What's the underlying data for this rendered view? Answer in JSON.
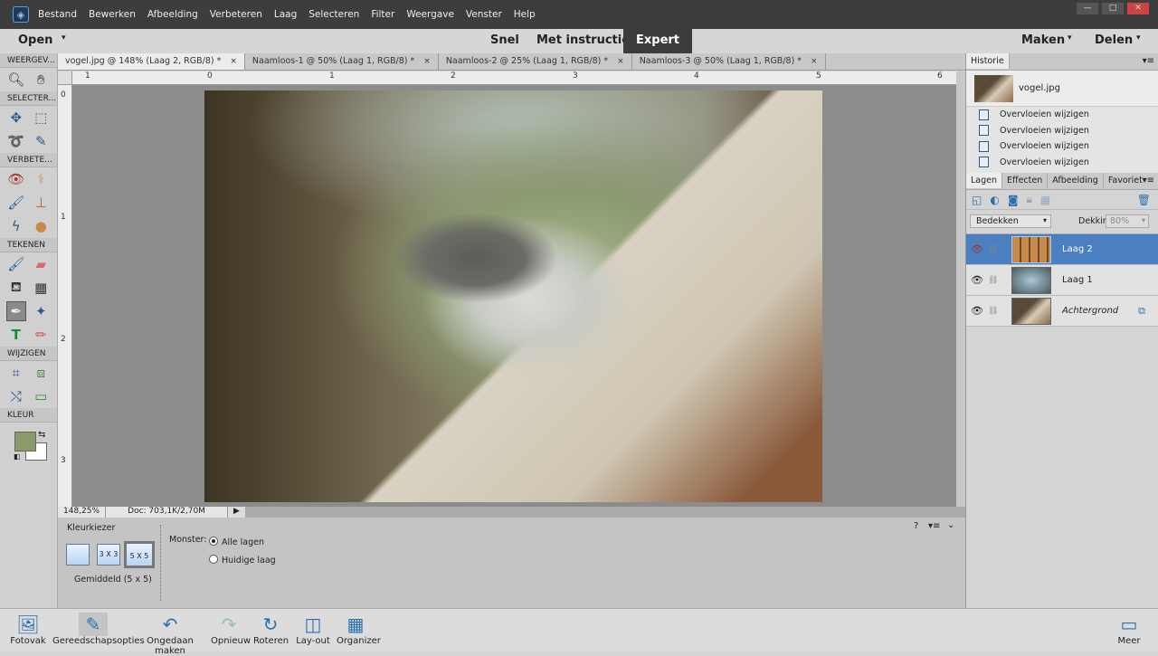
{
  "menu": [
    "Bestand",
    "Bewerken",
    "Afbeelding",
    "Verbeteren",
    "Laag",
    "Selecteren",
    "Filter",
    "Weergave",
    "Venster",
    "Help"
  ],
  "window_controls": {
    "minimize": "—",
    "maximize": "□",
    "close": "✕"
  },
  "modebar": {
    "open": "Open",
    "modes": [
      "Snel",
      "Met instructies",
      "Expert"
    ],
    "active_mode": "Expert",
    "maken": "Maken",
    "delen": "Delen"
  },
  "toolbox": {
    "sections": [
      "WEERGEV...",
      "SELECTER...",
      "VERBETE...",
      "TEKENEN",
      "WIJZIGEN",
      "KLEUR"
    ],
    "foreground_color": "#8a9a68",
    "background_color": "#ffffff"
  },
  "doc_tabs": [
    {
      "label": "vogel.jpg @ 148% (Laag 2, RGB/8) *",
      "close": "×"
    },
    {
      "label": "Naamloos-1 @ 50% (Laag 1, RGB/8) *",
      "close": "×"
    },
    {
      "label": "Naamloos-2 @ 25% (Laag 1, RGB/8) *",
      "close": "×"
    },
    {
      "label": "Naamloos-3 @ 50% (Laag 1, RGB/8) *",
      "close": "×"
    }
  ],
  "ruler_h": [
    "1",
    "0",
    "1",
    "2",
    "3",
    "4",
    "5",
    "6"
  ],
  "ruler_v": [
    "0",
    "1",
    "2",
    "3"
  ],
  "status": {
    "zoom": "148,25%",
    "doc": "Doc: 703,1K/2,70M"
  },
  "tool_options": {
    "title": "Kleurkiezer",
    "sizes": [
      "",
      "3 X 3",
      "5 X 5"
    ],
    "size_label": "Gemiddeld (5 x 5)",
    "monster_label": "Monster:",
    "options": [
      "Alle lagen",
      "Huidige laag"
    ],
    "selected": "Alle lagen"
  },
  "history": {
    "tab": "Historie",
    "source": "vogel.jpg",
    "items": [
      "Overvloeien wijzigen",
      "Overvloeien wijzigen",
      "Overvloeien wijzigen",
      "Overvloeien wijzigen"
    ]
  },
  "layers_panel": {
    "tabs": [
      "Lagen",
      "Effecten",
      "Afbeelding",
      "Favorieten"
    ],
    "blend_mode": "Bedekken",
    "opacity_label": "Dekking:",
    "opacity": "80%",
    "layers": [
      {
        "name": "Laag 2",
        "selected": true
      },
      {
        "name": "Laag 1",
        "selected": false
      },
      {
        "name": "Achtergrond",
        "selected": false
      }
    ]
  },
  "taskbar": [
    "Fotovak",
    "Gereedschapsopties",
    "Ongedaan maken",
    "Opnieuw",
    "Roteren",
    "Lay-out",
    "Organizer"
  ],
  "taskbar_more": "Meer"
}
